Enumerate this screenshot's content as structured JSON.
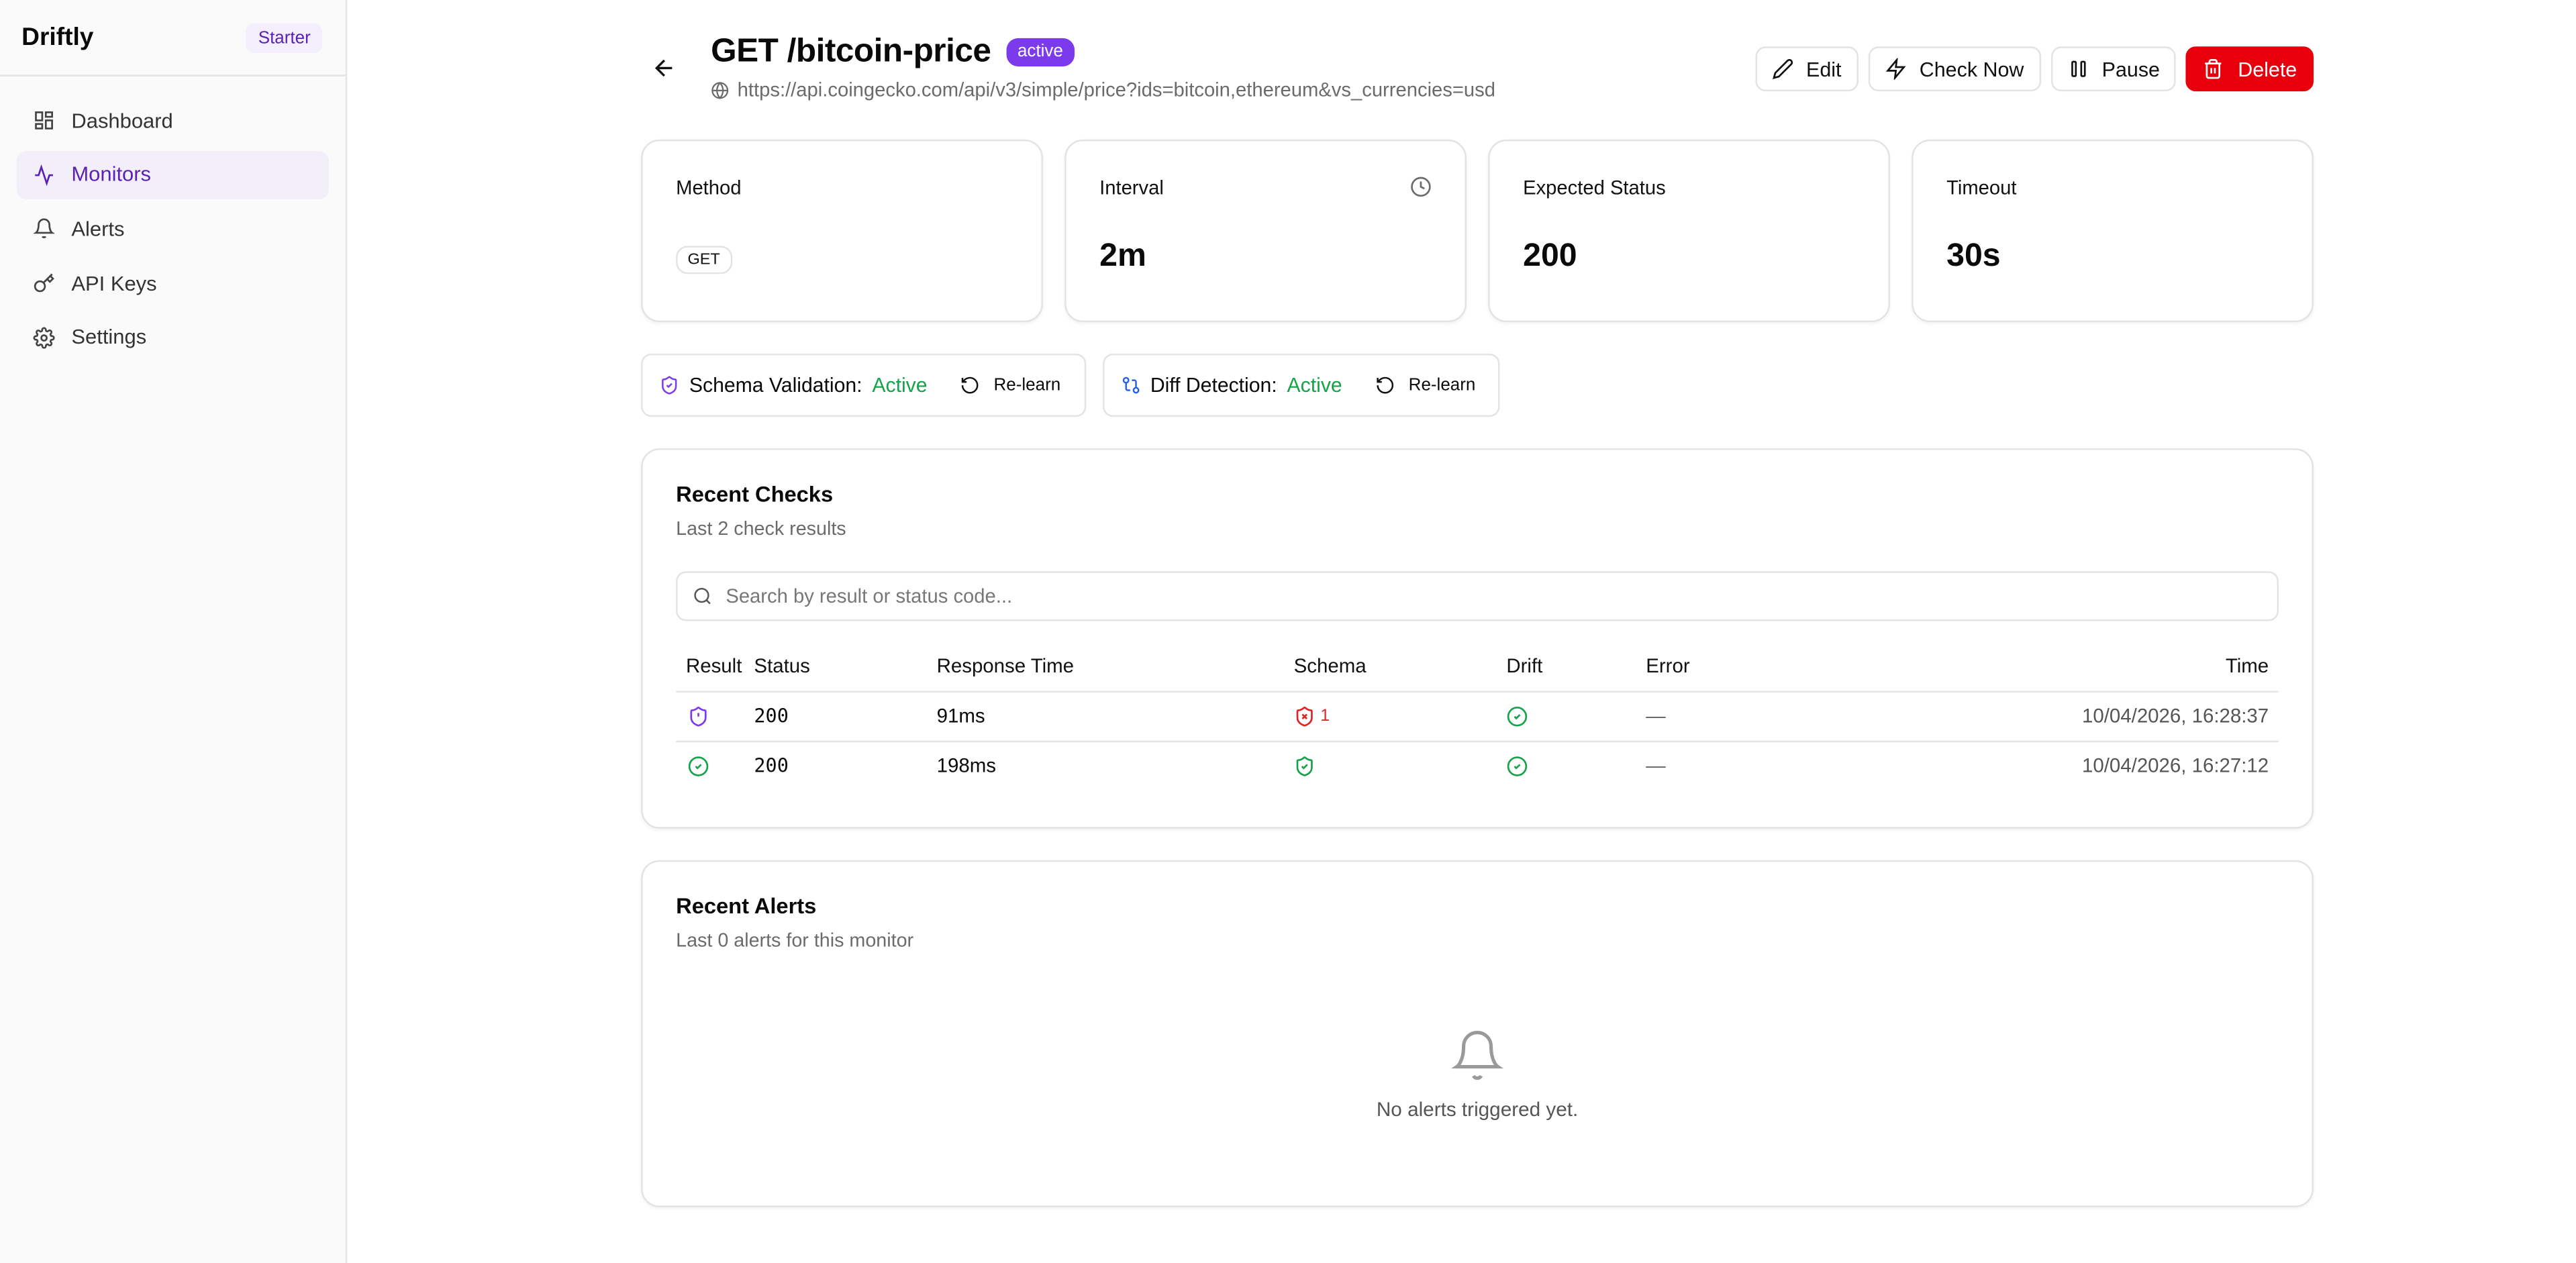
{
  "sidebar": {
    "brand": "Driftly",
    "plan": "Starter",
    "items": [
      {
        "label": "Dashboard",
        "icon": "dashboard-icon"
      },
      {
        "label": "Monitors",
        "icon": "activity-icon",
        "active": true
      },
      {
        "label": "Alerts",
        "icon": "bell-icon"
      },
      {
        "label": "API Keys",
        "icon": "key-icon"
      },
      {
        "label": "Settings",
        "icon": "gear-icon"
      }
    ]
  },
  "header": {
    "title": "GET /bitcoin-price",
    "status": "active",
    "url": "https://api.coingecko.com/api/v3/simple/price?ids=bitcoin,ethereum&vs_currencies=usd",
    "actions": {
      "edit": "Edit",
      "check_now": "Check Now",
      "pause": "Pause",
      "delete": "Delete"
    }
  },
  "stats": {
    "method": {
      "label": "Method",
      "value": "GET"
    },
    "interval": {
      "label": "Interval",
      "value": "2m"
    },
    "expected_status": {
      "label": "Expected Status",
      "value": "200"
    },
    "timeout": {
      "label": "Timeout",
      "value": "30s"
    }
  },
  "toggles": {
    "schema": {
      "label": "Schema Validation:",
      "state": "Active",
      "action": "Re-learn"
    },
    "diff": {
      "label": "Diff Detection:",
      "state": "Active",
      "action": "Re-learn"
    }
  },
  "recent_checks": {
    "title": "Recent Checks",
    "subtitle": "Last 2 check results",
    "search_placeholder": "Search by result or status code...",
    "columns": [
      "Result",
      "Status",
      "Response Time",
      "Schema",
      "Drift",
      "Error",
      "Time"
    ],
    "rows": [
      {
        "result": "schema-warning",
        "status": "200",
        "response_time": "91ms",
        "schema": "fail",
        "schema_count": "1",
        "drift": "ok",
        "error": "—",
        "time": "10/04/2026, 16:28:37"
      },
      {
        "result": "ok",
        "status": "200",
        "response_time": "198ms",
        "schema": "ok",
        "schema_count": "",
        "drift": "ok",
        "error": "—",
        "time": "10/04/2026, 16:27:12"
      }
    ]
  },
  "recent_alerts": {
    "title": "Recent Alerts",
    "subtitle": "Last 0 alerts for this monitor",
    "empty_text": "No alerts triggered yet."
  },
  "colors": {
    "accent": "#7c3aed",
    "danger": "#e7000b",
    "success": "#16a34a"
  }
}
